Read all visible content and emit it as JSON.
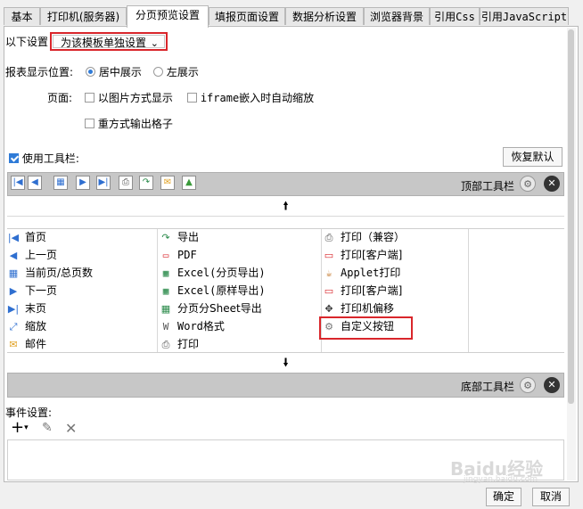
{
  "tabs": [
    "基本",
    "打印机(服务器)",
    "分页预览设置",
    "填报页面设置",
    "数据分析设置",
    "浏览器背景",
    "引用Css",
    "引用JavaScript"
  ],
  "active_tab": "分页预览设置",
  "settings": {
    "scope_label": "以下设置",
    "scope_value": "为该模板单独设置",
    "position_label": "报表显示位置:",
    "center_option": "居中展示",
    "left_option": "左展示",
    "page_label": "页面:",
    "image_mode": "以图片方式显示",
    "iframe_autoscale": "iframe嵌入时自动缩放",
    "repeat_output_grid": "重方式输出格子"
  },
  "toolbar": {
    "use_label": "使用工具栏:",
    "reset_label": "恢复默认",
    "top_label": "顶部工具栏",
    "bottom_label": "底部工具栏"
  },
  "buttons_grid": [
    [
      "首页",
      "导出",
      "打印（兼容）"
    ],
    [
      "上一页",
      "PDF",
      "打印[客户端]"
    ],
    [
      "当前页/总页数",
      "Excel(分页导出)",
      "Applet打印"
    ],
    [
      "下一页",
      "Excel(原样导出)",
      "打印[客户端]"
    ],
    [
      "末页",
      "分页分Sheet导出",
      "打印机偏移"
    ],
    [
      "缩放",
      "Word格式",
      "自定义按钮"
    ],
    [
      "邮件",
      "打印",
      ""
    ]
  ],
  "events": {
    "label": "事件设置:"
  },
  "footer": {
    "ok": "确定",
    "cancel": "取消"
  },
  "watermark": {
    "text": "Baidu经验",
    "sub": "jingyan.baidu.com"
  },
  "colors": {
    "highlight": "#d9262b",
    "accent": "#2f7bd7"
  }
}
